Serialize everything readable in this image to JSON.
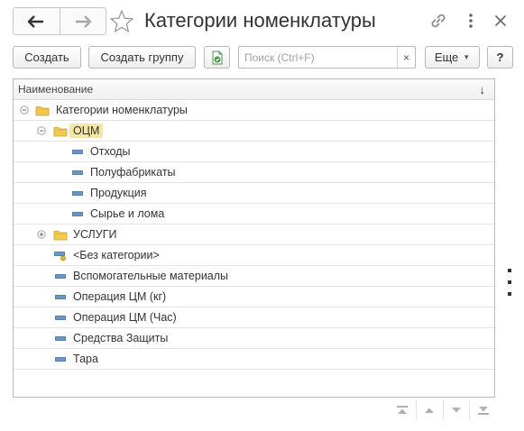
{
  "window": {
    "title": "Категории номенклатуры"
  },
  "toolbar": {
    "create_label": "Создать",
    "create_group_label": "Создать группу",
    "search_placeholder": "Поиск (Ctrl+F)",
    "search_value": "",
    "search_clear": "×",
    "more_label": "Еще",
    "help_label": "?"
  },
  "tree": {
    "column_header": "Наименование",
    "sort_indicator": "↓",
    "rows": [
      {
        "label": "Категории номенклатуры",
        "level": 0,
        "type": "folder",
        "expanded": true
      },
      {
        "label": "ОЦМ",
        "level": 1,
        "type": "folder",
        "expanded": true,
        "selected": true
      },
      {
        "label": "Отходы",
        "level": 2,
        "type": "item"
      },
      {
        "label": "Полуфабрикаты",
        "level": 2,
        "type": "item"
      },
      {
        "label": "Продукция",
        "level": 2,
        "type": "item"
      },
      {
        "label": "Сырье и лома",
        "level": 2,
        "type": "item"
      },
      {
        "label": "УСЛУГИ",
        "level": 1,
        "type": "folder",
        "expanded": false
      },
      {
        "label": "<Без категории>",
        "level": 1,
        "type": "item-special"
      },
      {
        "label": "Вспомогательные материалы",
        "level": 1,
        "type": "item"
      },
      {
        "label": "Операция ЦМ (кг)",
        "level": 1,
        "type": "item"
      },
      {
        "label": "Операция ЦМ (Час)",
        "level": 1,
        "type": "item"
      },
      {
        "label": "Средства Защиты",
        "level": 1,
        "type": "item"
      },
      {
        "label": "Тара",
        "level": 1,
        "type": "item"
      }
    ]
  },
  "colors": {
    "selection": "#f6e6a5",
    "folder": "#f2c94c",
    "item_marker": "#4a7aa8",
    "excel_green": "#3e9a3e"
  }
}
